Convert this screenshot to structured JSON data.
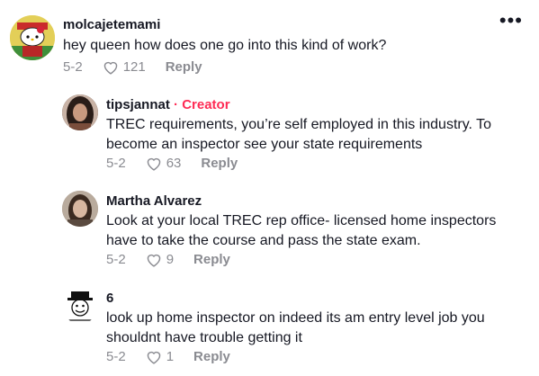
{
  "comments": [
    {
      "username": "molcajetemami",
      "text": "hey queen how does one go into this kind of work?",
      "date": "5-2",
      "likes": "121",
      "reply_label": "Reply"
    },
    {
      "username": "tipsjannat",
      "separator": "·",
      "badge": "Creator",
      "text": "TREC requirements, you’re self employed in this industry. To become an inspector see your state requirements",
      "date": "5-2",
      "likes": "63",
      "reply_label": "Reply"
    },
    {
      "username": "Martha Alvarez",
      "text": "Look at your local TREC rep office- licensed home inspectors have to take the course and pass the state exam.",
      "date": "5-2",
      "likes": "9",
      "reply_label": "Reply"
    },
    {
      "username": "6",
      "text": "look up home inspector on indeed its am entry level job you shouldnt have trouble getting it",
      "date": "5-2",
      "likes": "1",
      "reply_label": "Reply"
    }
  ],
  "more_icon": "more-horizontal-icon",
  "colors": {
    "accent": "#fe2c55",
    "muted": "#8a8b91",
    "text": "#161823"
  }
}
